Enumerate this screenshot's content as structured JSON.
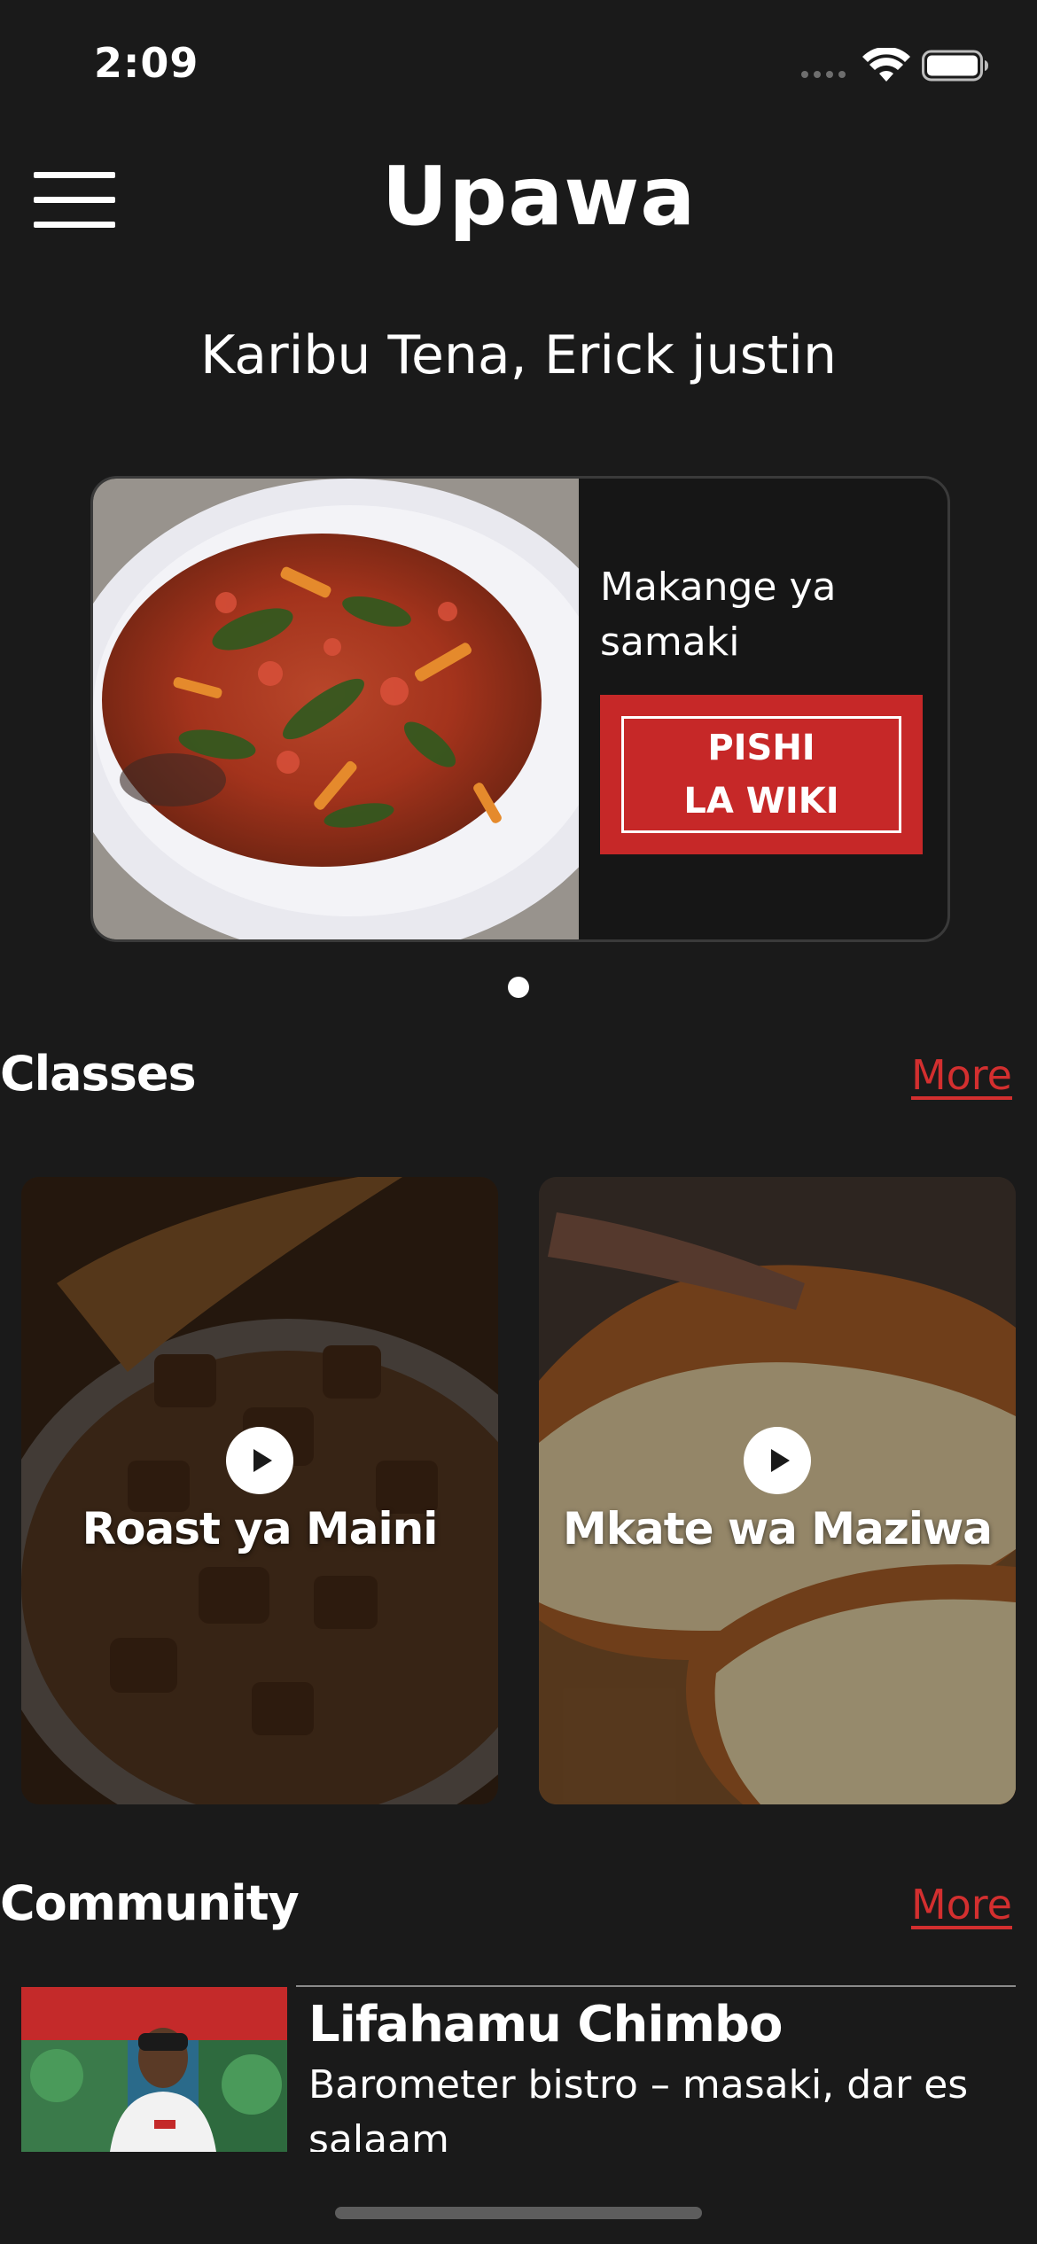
{
  "status_bar": {
    "time": "2:09",
    "icons": [
      "cellular-signal-icon",
      "wifi-icon",
      "battery-icon"
    ]
  },
  "header": {
    "menu_icon": "hamburger-menu-icon",
    "title": "Upawa"
  },
  "greeting": "Karibu Tena, Erick justin",
  "featured": {
    "dish_name": "Makange ya samaki",
    "button_line1": "PISHI",
    "button_line2": "LA WIKI",
    "carousel_pages": 1,
    "carousel_active": 1
  },
  "classes": {
    "title": "Classes",
    "more_label": "More",
    "items": [
      {
        "title": "Roast ya Maini",
        "icon": "play-icon"
      },
      {
        "title": "Mkate wa Maziwa",
        "icon": "play-icon"
      }
    ]
  },
  "community": {
    "title": "Community",
    "more_label": "More",
    "items": [
      {
        "name": "Lifahamu Chimbo",
        "description": "Barometer bistro – masaki, dar es salaam"
      }
    ]
  },
  "colors": {
    "background": "#1a1a1a",
    "accent": "#c62828",
    "link": "#d32f2f",
    "text": "#ffffff"
  }
}
